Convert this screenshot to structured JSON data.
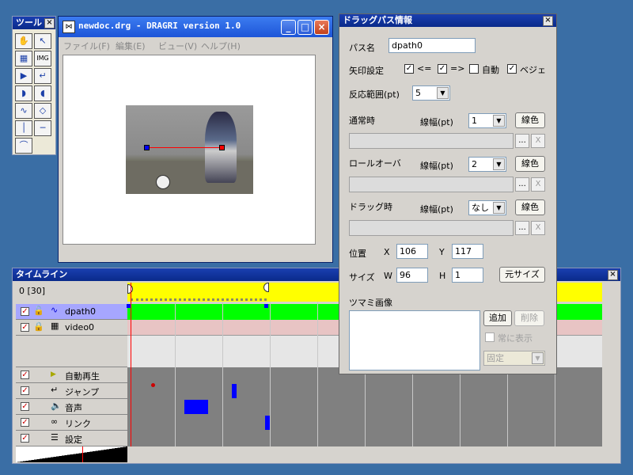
{
  "tool_window": {
    "title": "ツール",
    "close": "×",
    "tools": [
      {
        "name": "hand-tool",
        "glyph": "✋"
      },
      {
        "name": "arrow-tool",
        "glyph": "↖"
      },
      {
        "name": "film-tool",
        "glyph": "▦"
      },
      {
        "name": "img-tool",
        "glyph": "IMG"
      },
      {
        "name": "play-tool",
        "glyph": "▶"
      },
      {
        "name": "return-tool",
        "glyph": "↵"
      },
      {
        "name": "half-right-tool",
        "glyph": "◗"
      },
      {
        "name": "half-left-tool",
        "glyph": "◖"
      },
      {
        "name": "path-tool",
        "glyph": "∿"
      },
      {
        "name": "diamond-tool",
        "glyph": "◇"
      },
      {
        "name": "vline-tool",
        "glyph": "│"
      },
      {
        "name": "hline-tool",
        "glyph": "─"
      },
      {
        "name": "curve-tool",
        "glyph": "⌒"
      }
    ]
  },
  "doc_window": {
    "title": "newdoc.drg - DRAGRI version 1.0",
    "menu": [
      "ファイル(F)",
      "編集(E)",
      "ビュー(V)",
      "ヘルプ(H)"
    ],
    "min": "_",
    "max": "□",
    "close": "×"
  },
  "props": {
    "title": "ドラッグパス情報",
    "close": "×",
    "path_name_label": "パス名",
    "path_name": "dpath0",
    "arrow_label": "矢印設定",
    "arrow_opts": [
      {
        "label": "<=",
        "checked": true
      },
      {
        "label": "=>",
        "checked": true
      },
      {
        "label": "自動",
        "checked": false
      },
      {
        "label": "ベジェ",
        "checked": true
      }
    ],
    "range_label": "反応範囲(pt)",
    "range_value": "5",
    "normal_label": "通常時",
    "rollover_label": "ロールオーバ",
    "drag_label": "ドラッグ時",
    "line_width_label": "線幅(pt)",
    "normal_width": "1",
    "rollover_width": "2",
    "drag_width": "なし",
    "line_color_btn": "線色",
    "browse_btn": "...",
    "clear_btn": "X",
    "pos_label": "位置",
    "x_label": "X",
    "x_value": "106",
    "y_label": "Y",
    "y_value": "117",
    "size_label": "サイズ",
    "w_label": "W",
    "w_value": "96",
    "h_label": "H",
    "h_value": "1",
    "orig_size_btn": "元サイズ",
    "knob_label": "ツマミ画像",
    "add_btn": "追加",
    "delete_btn": "削除",
    "always_show": "常に表示",
    "fixed": "固定"
  },
  "timeline": {
    "title": "タイムライン",
    "close": "×",
    "frame": "0 [30]",
    "layers": [
      {
        "name": "dpath0"
      },
      {
        "name": "video0"
      }
    ],
    "events": [
      "自動再生",
      "ジャンプ",
      "音声",
      "リンク",
      "設定"
    ]
  },
  "colors": {
    "accent": "#0000ff",
    "track_green": "#00ff00",
    "track_pink": "#e8c4c4",
    "ruler_yellow": "#ffff00"
  }
}
